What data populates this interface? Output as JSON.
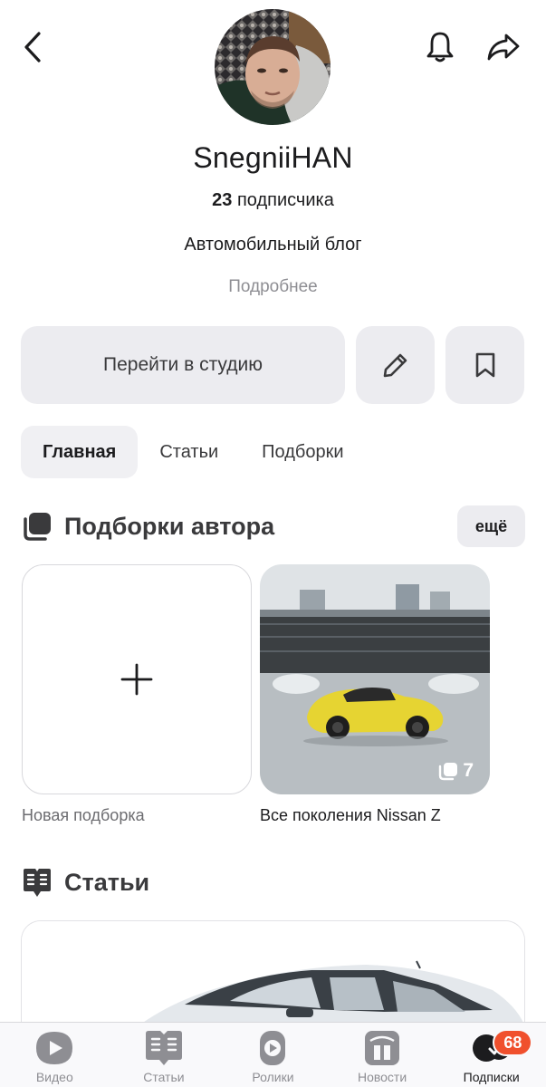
{
  "header": {
    "back_icon": "chevron-left-icon",
    "bell_icon": "bell-icon",
    "share_icon": "share-arrow-icon"
  },
  "profile": {
    "name": "SnegniiHAN",
    "subscribers_count": "23",
    "subscribers_label": "подписчика",
    "description": "Автомобильный блог",
    "more_link": "Подробнее"
  },
  "actions": {
    "studio_label": "Перейти в студию",
    "edit_icon": "pencil-icon",
    "bookmark_icon": "bookmark-icon"
  },
  "tabs": [
    {
      "label": "Главная",
      "active": true
    },
    {
      "label": "Статьи",
      "active": false
    },
    {
      "label": "Подборки",
      "active": false
    }
  ],
  "collections": {
    "title": "Подборки автора",
    "more_label": "ещё",
    "new_label": "Новая подборка",
    "items": [
      {
        "title": "Все поколения Nissan Z",
        "count": "7"
      }
    ]
  },
  "articles": {
    "title": "Статьи"
  },
  "bottom_nav": {
    "items": [
      {
        "label": "Видео",
        "icon": "video-play-icon",
        "active": false
      },
      {
        "label": "Статьи",
        "icon": "articles-icon",
        "active": false
      },
      {
        "label": "Ролики",
        "icon": "shorts-icon",
        "active": false
      },
      {
        "label": "Новости",
        "icon": "news-icon",
        "active": false
      },
      {
        "label": "Подписки",
        "icon": "subscriptions-icon",
        "active": true,
        "badge": "68"
      }
    ]
  },
  "colors": {
    "badge": "#f0502d",
    "button_bg": "#ececf0",
    "muted_text": "#8e8e93"
  }
}
